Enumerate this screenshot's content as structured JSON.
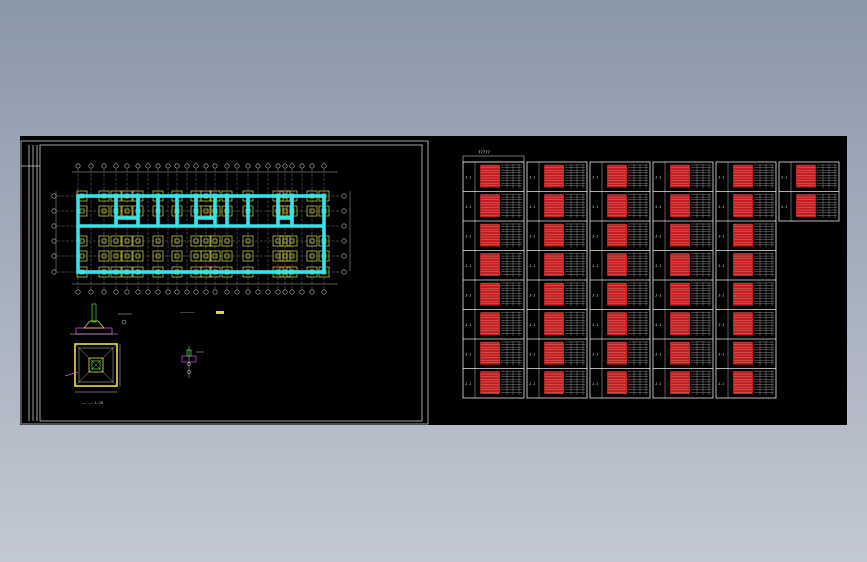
{
  "canvas": {
    "background_color": "#000000",
    "desktop_gradient": [
      "#8b98aa",
      "#c3c8d2"
    ]
  },
  "colors": {
    "beam": "#33e6ee",
    "column_pad": "#d9d64a",
    "grid_line": "#9a9a9a",
    "frame": "#c8c8c8",
    "table_red": "#d92020",
    "table_text": "#e6e6e6",
    "detail_yellow": "#e8e04a",
    "detail_green": "#3ccf3c",
    "detail_magenta": "#d84ad8"
  },
  "drawing_sheet": {
    "name": "foundation-plan-sheet"
  },
  "schedule": {
    "title": "?????",
    "row_tag": "J-1",
    "groups": 6
  },
  "plan_title": "——————",
  "detail_title": "—— —— 1:20"
}
